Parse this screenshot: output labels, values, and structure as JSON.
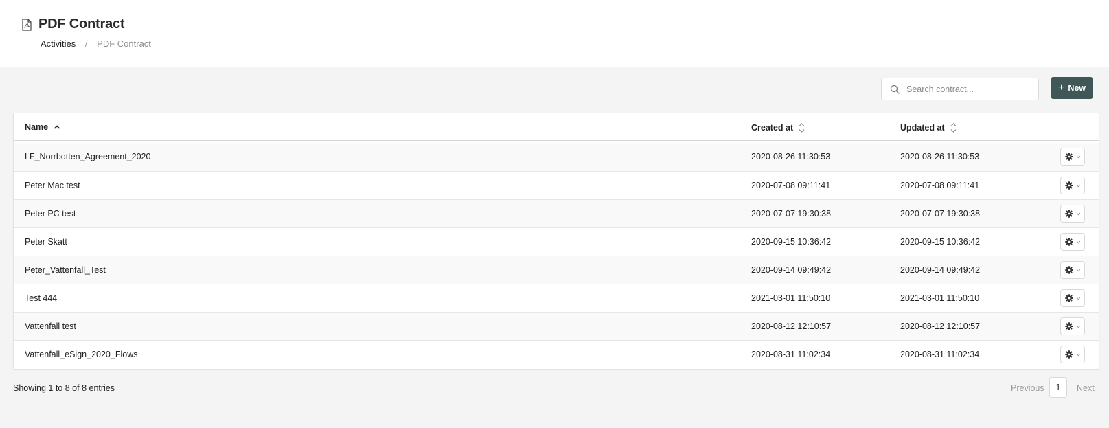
{
  "header": {
    "title": "PDF Contract",
    "title_icon": "pdf-file-icon",
    "breadcrumb": {
      "parent": "Activities",
      "separator": "/",
      "current": "PDF Contract"
    }
  },
  "toolbar": {
    "search_placeholder": "Search contract...",
    "search_value": "",
    "new_button_label": "New",
    "new_button_icon": "plus-icon",
    "accent_color": "#3f5857"
  },
  "table": {
    "columns": {
      "name": "Name",
      "created": "Created at",
      "updated": "Updated at"
    },
    "sort": {
      "column": "Name",
      "direction": "ascending"
    },
    "rows": [
      {
        "name": "LF_Norrbotten_Agreement_2020",
        "created": "2020-08-26 11:30:53",
        "updated": "2020-08-26 11:30:53"
      },
      {
        "name": "Peter Mac test",
        "created": "2020-07-08 09:11:41",
        "updated": "2020-07-08 09:11:41"
      },
      {
        "name": "Peter PC test",
        "created": "2020-07-07 19:30:38",
        "updated": "2020-07-07 19:30:38"
      },
      {
        "name": "Peter Skatt",
        "created": "2020-09-15 10:36:42",
        "updated": "2020-09-15 10:36:42"
      },
      {
        "name": "Peter_Vattenfall_Test",
        "created": "2020-09-14 09:49:42",
        "updated": "2020-09-14 09:49:42"
      },
      {
        "name": "Test 444",
        "created": "2021-03-01 11:50:10",
        "updated": "2021-03-01 11:50:10"
      },
      {
        "name": "Vattenfall test",
        "created": "2020-08-12 12:10:57",
        "updated": "2020-08-12 12:10:57"
      },
      {
        "name": "Vattenfall_eSign_2020_Flows",
        "created": "2020-08-31 11:02:34",
        "updated": "2020-08-31 11:02:34"
      }
    ],
    "row_action_icon": "gear-icon"
  },
  "footer": {
    "info": "Showing 1 to 8 of 8 entries",
    "previous_label": "Previous",
    "current_page": "1",
    "next_label": "Next"
  }
}
